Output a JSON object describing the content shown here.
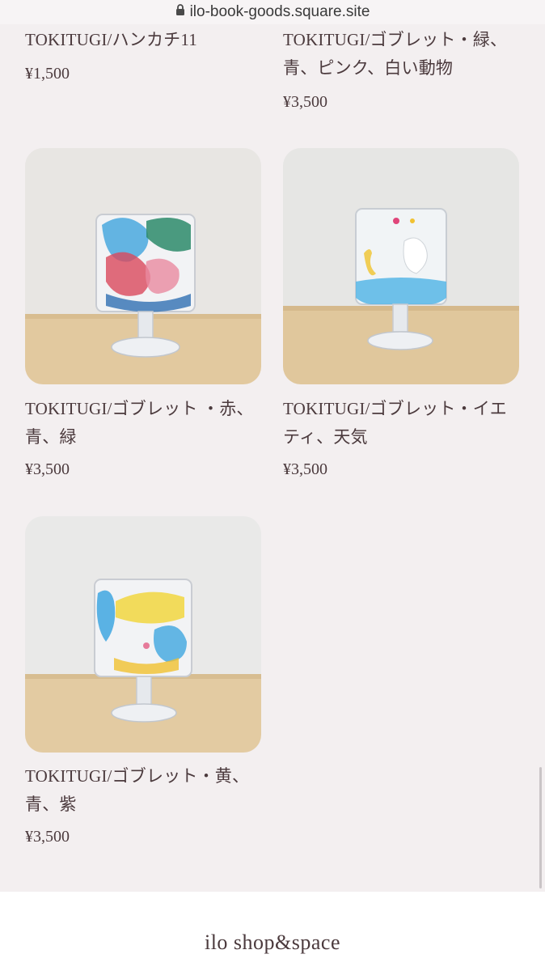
{
  "browser": {
    "url": "ilo-book-goods.square.site"
  },
  "products": [
    {
      "name": "TOKITUGI/ハンカチ11",
      "price": "¥1,500"
    },
    {
      "name": "TOKITUGI/ゴブレット・緑、青、ピンク、白い動物",
      "price": "¥3,500"
    },
    {
      "name": "TOKITUGI/ゴブレット ・赤、青、緑",
      "price": "¥3,500"
    },
    {
      "name": "TOKITUGI/ゴブレット・イエティ、天気",
      "price": "¥3,500"
    },
    {
      "name": "TOKITUGI/ゴブレット・黄、青、紫",
      "price": "¥3,500"
    }
  ],
  "footer": {
    "shop_name": "ilo shop&space"
  },
  "icons": {
    "lock": "lock-icon"
  }
}
